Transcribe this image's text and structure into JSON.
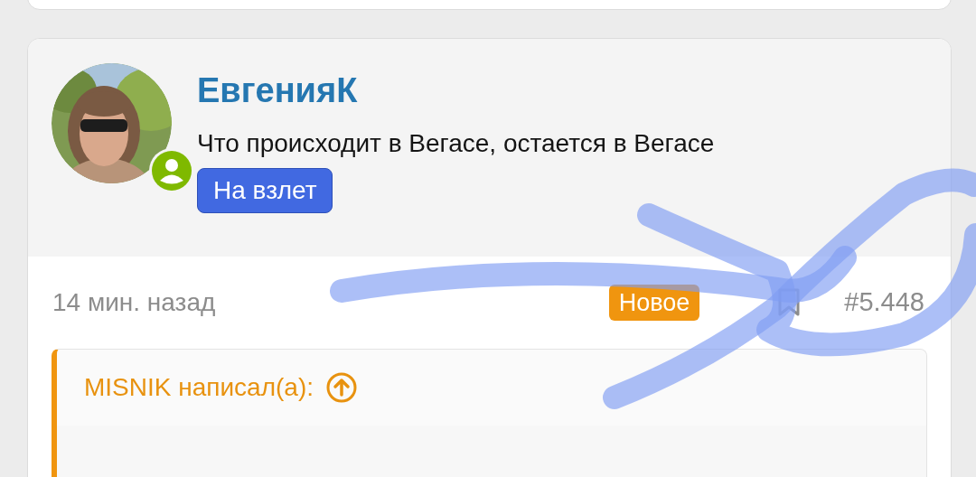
{
  "post": {
    "author": {
      "name": "ЕвгенияК",
      "online": true,
      "user_title": "Что происходит в Вегасе, остается в Вегасе",
      "rank_badge": "На взлет"
    },
    "meta": {
      "time": "14 мин. назад",
      "new_badge": "Новое",
      "bookmarked": false,
      "post_number": "#5.448"
    },
    "quote": {
      "attribution": "MISNIK написал(а):"
    }
  }
}
